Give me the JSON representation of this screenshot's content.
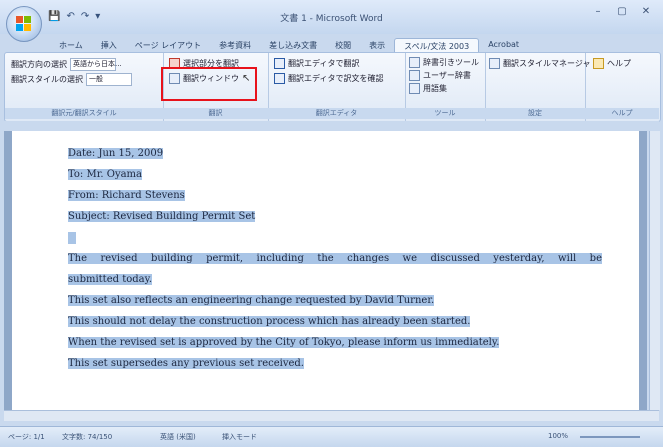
{
  "window": {
    "title": "文書 1 - Microsoft Word",
    "quick_access": [
      "💾",
      "↶",
      "↷",
      "▾"
    ],
    "controls": [
      "–",
      "▢",
      "✕"
    ]
  },
  "tabs": [
    "ホーム",
    "挿入",
    "ページ レイアウト",
    "参考資料",
    "差し込み文書",
    "校閲",
    "表示",
    "スペル/文法 2003",
    "Acrobat"
  ],
  "ribbon": {
    "groups": [
      {
        "label": "翻訳元/翻訳スタイル",
        "items": [
          {
            "label": "翻訳方向の選択",
            "value": "英語から日本..."
          },
          {
            "label": "翻訳スタイルの選択",
            "value": "一般"
          }
        ]
      },
      {
        "label": "翻訳",
        "items": [
          "選択部分を翻訳",
          "翻訳ウィンドウ"
        ]
      },
      {
        "label": "翻訳エディタ",
        "items": [
          "翻訳エディタで翻訳",
          "翻訳エディタで訳文を確認"
        ]
      },
      {
        "label": "ツール",
        "items": [
          "辞書引きツール",
          "ユーザー辞書",
          "用語集"
        ]
      },
      {
        "label": "設定",
        "items": [
          "翻訳スタイルマネージャ"
        ]
      },
      {
        "label": "ヘルプ",
        "items": [
          "ヘルプ"
        ]
      }
    ]
  },
  "document": {
    "lines": [
      "Date: Jun 15, 2009",
      "To: Mr. Oyama",
      "From: Richard Stevens",
      "Subject: Revised Building Permit Set",
      "",
      "The revised building permit, including the changes we discussed yesterday, will be",
      "submitted today.",
      "This set also reflects an engineering change requested by David Turner.",
      "This should not delay the construction process which has already been started.",
      "When the revised set is approved by the City of Tokyo, please inform us immediately.",
      "This set supersedes any previous set received."
    ]
  },
  "status": {
    "page": "ページ: 1/1",
    "words": "文字数: 74/150",
    "language": "英語 (米国)",
    "mode": "挿入モード",
    "zoom": "100%"
  },
  "colors": {
    "selection": "#a8c4e6",
    "highlight_box": "#e8121b",
    "ribbon_bg": "#dfe9f6"
  }
}
